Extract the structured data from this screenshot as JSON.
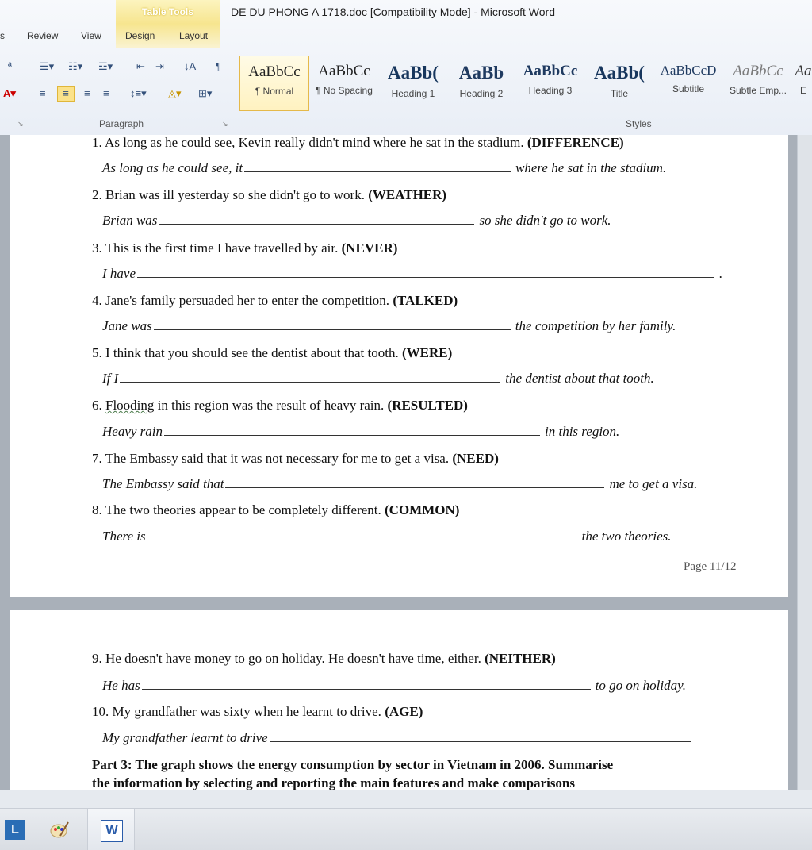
{
  "window": {
    "title": "DE DU PHONG A 1718.doc [Compatibility Mode] - Microsoft Word",
    "contextual_tab_group": "Table Tools"
  },
  "tabs": [
    "s",
    "Review",
    "View",
    "Design",
    "Layout"
  ],
  "ribbon": {
    "paragraph_group_label": "Paragraph",
    "styles_group_label": "Styles",
    "styles": [
      {
        "preview": "AaBbCc",
        "name": "¶ Normal"
      },
      {
        "preview": "AaBbCc",
        "name": "¶ No Spacing"
      },
      {
        "preview": "AaBb(",
        "name": "Heading 1"
      },
      {
        "preview": "AaBb",
        "name": "Heading 2"
      },
      {
        "preview": "AaBbCc",
        "name": "Heading 3"
      },
      {
        "preview": "AaBb(",
        "name": "Title"
      },
      {
        "preview": "AaBbCcD",
        "name": "Subtitle"
      },
      {
        "preview": "AaBbCc",
        "name": "Subtle Emp..."
      },
      {
        "preview": "Aa",
        "name": "E"
      }
    ]
  },
  "document": {
    "page1": {
      "questions": [
        {
          "q": "1. As long as he could see, Kevin really didn't mind where he sat in the stadium.",
          "key": "(DIFFERENCE)",
          "pre": "As long as he could see, it",
          "post": "where he sat in the stadium."
        },
        {
          "q": "2. Brian was ill yesterday so she didn't go to work.",
          "key": "(WEATHER)",
          "pre": "Brian was",
          "post": "so she didn't go to work."
        },
        {
          "q": "3. This is the first time I have travelled by air.",
          "key": "(NEVER)",
          "pre": "I have",
          "post": "."
        },
        {
          "q": "4. Jane's family persuaded her to enter the competition.",
          "key": "(TALKED)",
          "pre": "Jane was",
          "post": "the competition by her family."
        },
        {
          "q": "5. I think that you should see the dentist about that tooth.",
          "key": "(WERE)",
          "pre": "If I",
          "post": "the dentist about that tooth."
        },
        {
          "q_num": "6. ",
          "q_word": "Flooding",
          "q_rest": " in this region was the result of heavy rain.",
          "key": "(RESULTED)",
          "pre": "Heavy rain",
          "post": "in this region."
        },
        {
          "q": "7. The Embassy said that it was not necessary for me to get a visa.",
          "key": "(NEED)",
          "pre": "The Embassy said that",
          "post": "me to get a visa."
        },
        {
          "q": "8. The two theories appear to be completely different.",
          "key": "(COMMON)",
          "pre": "There is",
          "post": "the two theories."
        }
      ],
      "page_number": "Page 11/12"
    },
    "page2": {
      "questions": [
        {
          "q": "9. He doesn't have money to go on holiday. He doesn't have time, either.",
          "key": "(NEITHER)",
          "pre": "He has",
          "post": "to go on holiday."
        },
        {
          "q": "10. My grandfather was sixty when he learnt to drive.",
          "key": "(AGE)",
          "pre": "My grandfather learnt to drive",
          "post": ""
        }
      ],
      "part3_line1": "Part 3: The graph shows the energy consumption by sector in Vietnam in 2006. Summarise",
      "part3_line2": "the information by selecting and reporting the main features and make comparisons"
    }
  },
  "taskbar": {
    "items": [
      {
        "icon": "lync-icon",
        "label": "L"
      },
      {
        "icon": "paint-icon",
        "label": ""
      },
      {
        "icon": "word-icon",
        "label": "W"
      }
    ]
  }
}
